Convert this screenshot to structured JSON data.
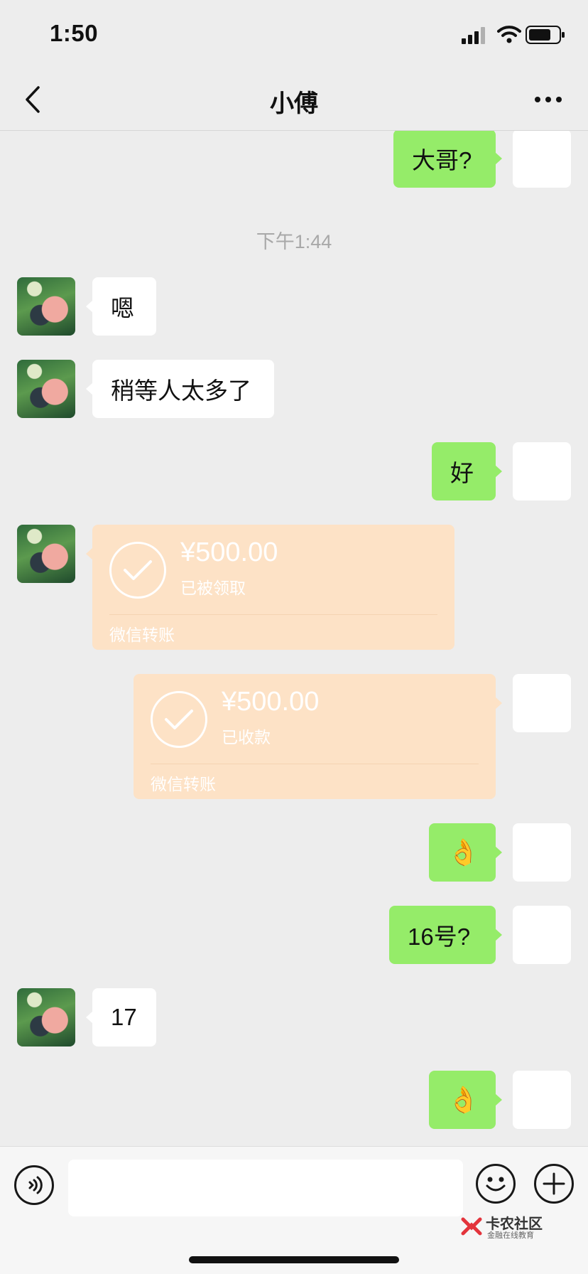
{
  "status_bar": {
    "time": "1:50",
    "signal_icon": "cellular-signal-icon",
    "wifi_icon": "wifi-icon",
    "battery_icon": "battery-icon"
  },
  "nav": {
    "title": "小傅",
    "back_icon": "chevron-left-icon",
    "more_icon": "more-dots-icon"
  },
  "messages": [
    {
      "side": "out",
      "text": "大哥?"
    },
    {
      "type": "timestamp",
      "text": "下午1:44"
    },
    {
      "side": "in",
      "text": "嗯"
    },
    {
      "side": "in",
      "text": "稍等人太多了"
    },
    {
      "side": "out",
      "text": "好"
    },
    {
      "side": "in",
      "type": "transfer",
      "amount": "¥500.00",
      "status": "已被领取",
      "footer": "微信转账"
    },
    {
      "side": "out",
      "type": "transfer",
      "amount": "¥500.00",
      "status": "已收款",
      "footer": "微信转账"
    },
    {
      "side": "out",
      "text": "👌"
    },
    {
      "side": "out",
      "text": "16号?"
    },
    {
      "side": "in",
      "text": "17"
    },
    {
      "side": "out",
      "text": "👌"
    }
  ],
  "input_bar": {
    "placeholder": "",
    "value": "",
    "voice_icon": "voice-icon",
    "emoji_icon": "emoji-smile-icon",
    "plus_icon": "plus-icon"
  },
  "watermark": {
    "title": "卡农社区",
    "subtitle": "金融在线教育"
  },
  "colors": {
    "background": "#ededed",
    "outgoing_bubble": "#95ec69",
    "incoming_bubble": "#ffffff",
    "transfer_card": "#fde2c6"
  }
}
